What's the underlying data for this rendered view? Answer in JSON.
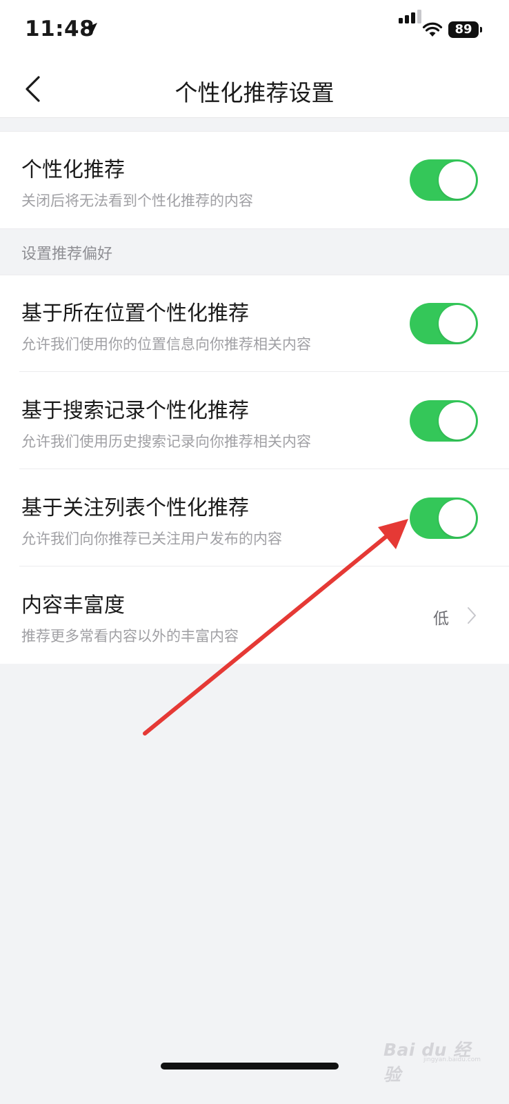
{
  "status_bar": {
    "time": "11:48",
    "battery": "89"
  },
  "nav": {
    "title": "个性化推荐设置"
  },
  "main_toggle": {
    "title": "个性化推荐",
    "subtitle": "关闭后将无法看到个性化推荐的内容",
    "enabled": true
  },
  "preferences": {
    "header": "设置推荐偏好",
    "items": [
      {
        "title": "基于所在位置个性化推荐",
        "subtitle": "允许我们使用你的位置信息向你推荐相关内容",
        "enabled": true
      },
      {
        "title": "基于搜索记录个性化推荐",
        "subtitle": "允许我们使用历史搜索记录向你推荐相关内容",
        "enabled": true
      },
      {
        "title": "基于关注列表个性化推荐",
        "subtitle": "允许我们向你推荐已关注用户发布的内容",
        "enabled": true
      }
    ],
    "richness": {
      "title": "内容丰富度",
      "subtitle": "推荐更多常看内容以外的丰富内容",
      "value": "低"
    }
  },
  "watermark": {
    "brand": "Bai du 经验",
    "url": "jingyan.baidu.com"
  },
  "colors": {
    "toggle_on": "#34c759",
    "annotation_arrow": "#e53935",
    "page_bg": "#f2f3f5"
  }
}
